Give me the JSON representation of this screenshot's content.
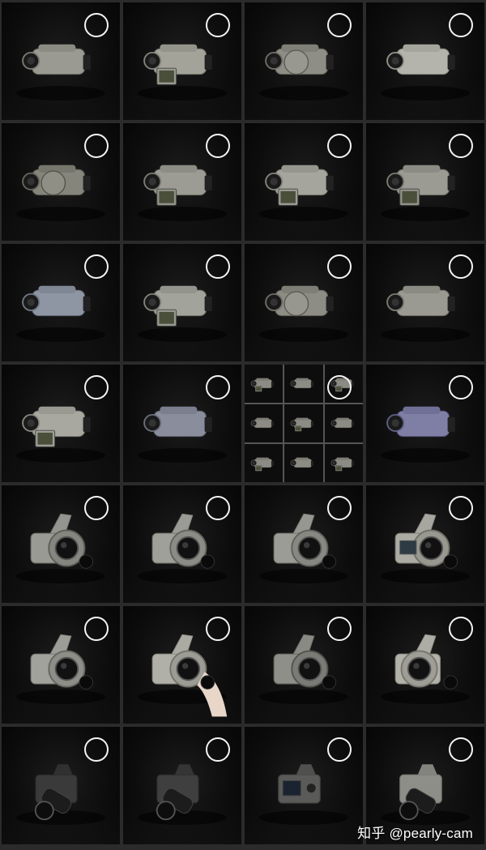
{
  "watermark": "知乎 @pearly-cam",
  "tiles": [
    {
      "kind": "camcorder",
      "color": "#9a9a92",
      "lcd": false
    },
    {
      "kind": "camcorder",
      "color": "#a3a39a",
      "lcd": true
    },
    {
      "kind": "camcorder-round",
      "color": "#8e8e86",
      "lcd": false
    },
    {
      "kind": "camcorder",
      "color": "#b4b4ac",
      "lcd": false
    },
    {
      "kind": "camcorder-round",
      "color": "#85857c",
      "lcd": false
    },
    {
      "kind": "camcorder",
      "color": "#9c9c94",
      "lcd": true
    },
    {
      "kind": "camcorder",
      "color": "#a5a59d",
      "lcd": true
    },
    {
      "kind": "camcorder",
      "color": "#9b9b93",
      "lcd": true
    },
    {
      "kind": "camcorder",
      "color": "#8f96a3",
      "lcd": false
    },
    {
      "kind": "camcorder",
      "color": "#a2a39b",
      "lcd": true
    },
    {
      "kind": "camcorder-round",
      "color": "#8d8d86",
      "lcd": false
    },
    {
      "kind": "camcorder",
      "color": "#9a9a93",
      "lcd": false
    },
    {
      "kind": "camcorder",
      "color": "#a8a8a0",
      "lcd": true
    },
    {
      "kind": "camcorder",
      "color": "#8a8d9c",
      "lcd": false
    },
    {
      "kind": "grid",
      "color": "#8c8c84",
      "lcd": false
    },
    {
      "kind": "camcorder",
      "color": "#7f7fa6",
      "lcd": false
    },
    {
      "kind": "bridge",
      "color": "#9a9a94",
      "lcd": false
    },
    {
      "kind": "bridge",
      "color": "#a0a09a",
      "lcd": false
    },
    {
      "kind": "bridge",
      "color": "#9c9c96",
      "lcd": false
    },
    {
      "kind": "bridge-back",
      "color": "#acaca4",
      "lcd": false
    },
    {
      "kind": "bridge-top",
      "color": "#a2a29c",
      "lcd": false
    },
    {
      "kind": "bridge-hand",
      "color": "#b0b0a8",
      "lcd": false
    },
    {
      "kind": "bridge",
      "color": "#8f8f8a",
      "lcd": false
    },
    {
      "kind": "bridge-front",
      "color": "#b2b2aa",
      "lcd": false
    },
    {
      "kind": "dslr-long",
      "color": "#3a3a3a",
      "lcd": false
    },
    {
      "kind": "dslr-long",
      "color": "#3f3f3f",
      "lcd": false
    },
    {
      "kind": "dslr-back",
      "color": "#5a5a58",
      "lcd": false
    },
    {
      "kind": "dslr-long",
      "color": "#8e8e88",
      "lcd": false
    }
  ]
}
